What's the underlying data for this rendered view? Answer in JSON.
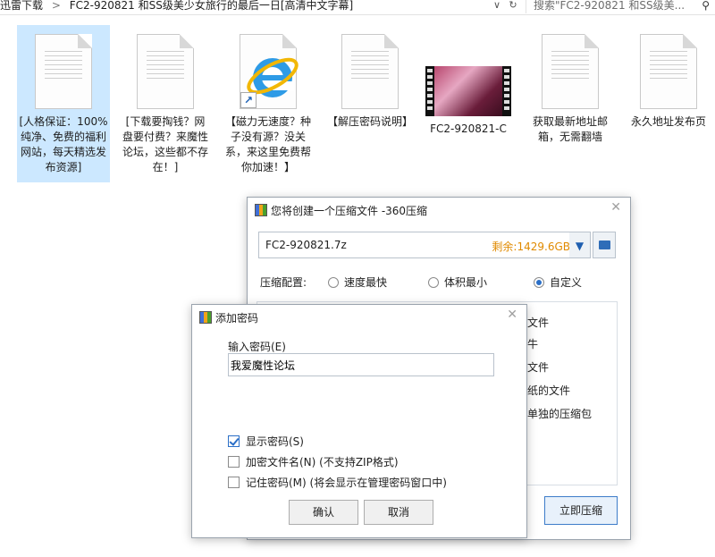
{
  "explorer": {
    "breadcrumb": [
      "迅雷下载",
      "FC2-920821 和SS级美少女旅行的最后一日[高清中文字幕]"
    ],
    "search_placeholder": "搜索\"FC2-920821 和SS级美...",
    "files": [
      {
        "label": "[人格保证：100%纯净、免费的福利网站，每天精选发布资源]",
        "icon": "text-file-icon",
        "selected": true
      },
      {
        "label": "[下载要掏钱？网盘要付费？来魔性论坛，这些都不存在！]",
        "icon": "text-file-icon",
        "selected": false
      },
      {
        "label": "【磁力无速度？种子没有源？没关系，来这里免费帮你加速！】",
        "icon": "internet-shortcut-icon",
        "selected": false
      },
      {
        "label": "【解压密码说明】",
        "icon": "text-file-icon",
        "selected": false
      },
      {
        "label": "FC2-920821-C",
        "icon": "video-thumbnail-icon",
        "selected": false
      },
      {
        "label": "获取最新地址邮箱，无需翻墙",
        "icon": "text-file-icon",
        "selected": false
      },
      {
        "label": "永久地址发布页",
        "icon": "text-file-icon",
        "selected": false
      }
    ]
  },
  "create_dialog": {
    "title": "您将创建一个压缩文件 -360压缩",
    "filename": "FC2-920821.7z",
    "free_space": "剩余:1429.6GB",
    "config_label": "压缩配置:",
    "radios": [
      "速度最快",
      "体积最小",
      "自定义"
    ],
    "selected_radio": "自定义",
    "visible_option_fragments": [
      "文件",
      "牛",
      "文件",
      "纸的文件",
      "单独的压缩包"
    ],
    "compress_button": "立即压缩"
  },
  "password_dialog": {
    "title": "添加密码",
    "input_label": "输入密码(E)",
    "input_value": "我爱魔性论坛",
    "checkboxes": [
      {
        "label": "显示密码(S)",
        "checked": true
      },
      {
        "label": "加密文件名(N) (不支持ZIP格式)",
        "checked": false
      },
      {
        "label": "记住密码(M) (将会显示在管理密码窗口中)",
        "checked": false
      }
    ],
    "ok_button": "确认",
    "cancel_button": "取消"
  },
  "colors": {
    "selection": "#cce8ff",
    "free_space": "#e08a00",
    "accent": "#2b6fc7"
  }
}
